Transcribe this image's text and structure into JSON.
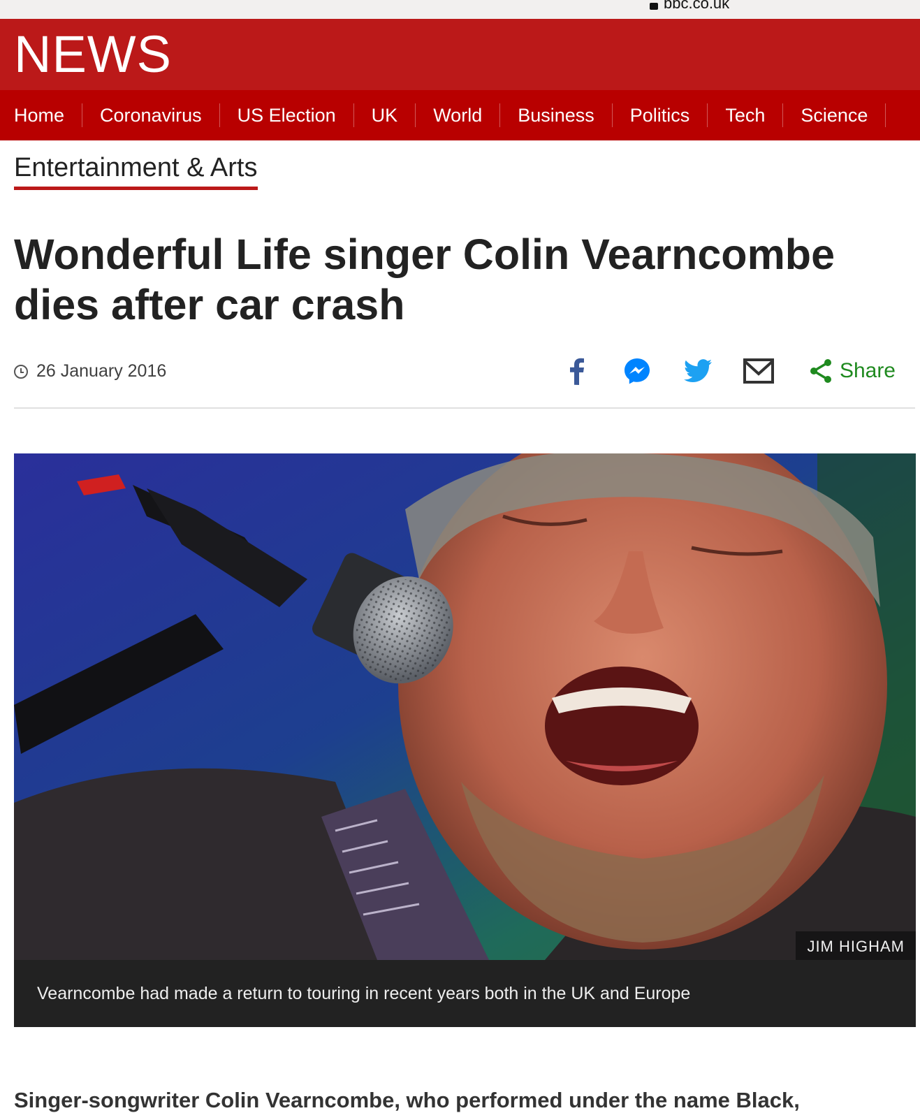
{
  "browser": {
    "url": "bbc.co.uk"
  },
  "masthead": {
    "logo": "NEWS",
    "bg_color": "#bb1919"
  },
  "nav": {
    "items": [
      "Home",
      "Coronavirus",
      "US Election",
      "UK",
      "World",
      "Business",
      "Politics",
      "Tech",
      "Science"
    ]
  },
  "section": {
    "label": "Entertainment & Arts"
  },
  "article": {
    "headline": "Wonderful Life singer Colin Vearncombe dies after car crash",
    "date": "26 January 2016",
    "share_label": "Share",
    "image": {
      "credit": "JIM HIGHAM",
      "caption": "Vearncombe had made a return to touring in recent years both in the UK and Europe"
    },
    "intro": "Singer-songwriter Colin Vearncombe, who performed under the name Black,"
  },
  "icons": {
    "facebook": "facebook-icon",
    "messenger": "messenger-icon",
    "twitter": "twitter-icon",
    "email": "email-icon",
    "share": "share-icon",
    "clock": "clock-icon",
    "lock": "lock-icon"
  },
  "colors": {
    "accent": "#bb1919",
    "share": "#1f8a1f",
    "facebook": "#3b5998",
    "messenger": "#0084ff",
    "twitter": "#1da1f2"
  }
}
